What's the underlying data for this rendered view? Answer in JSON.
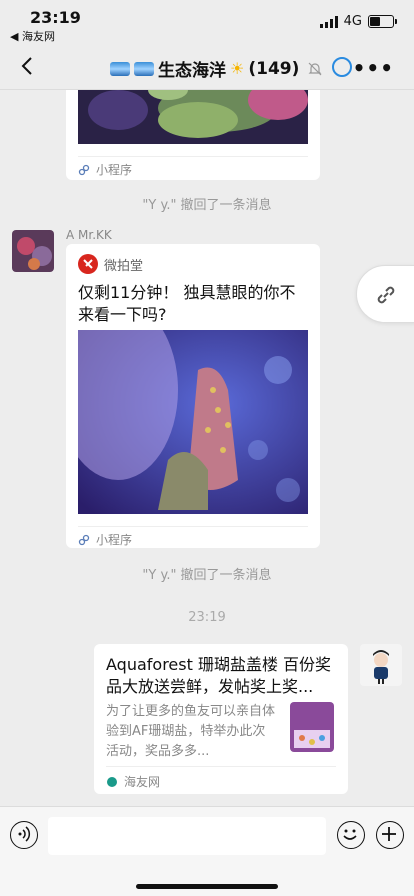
{
  "status_bar": {
    "time": "23:19",
    "back_app": "◀ 海友网",
    "network": "4G",
    "battery_level": 0.45
  },
  "nav": {
    "title": "生态海洋",
    "member_count": "(149)"
  },
  "messages": {
    "card1": {
      "footer": "小程序"
    },
    "recall1": "\"Y y.\" 撤回了一条消息",
    "sender2": "A  Mr.KK",
    "card2": {
      "source": "微拍堂",
      "title": "仅剩11分钟！ 独具慧眼的你不来看一下吗?",
      "footer": "小程序"
    },
    "recall2": "\"Y y.\" 撤回了一条消息",
    "time": "23:19",
    "card3": {
      "title": "Aquaforest 珊瑚盐盖楼 百份奖品大放送尝鲜，发帖奖上奖...",
      "desc": "为了让更多的鱼友可以亲自体验到AF珊瑚盐，特举办此次活动，奖品多多...",
      "source": "海友网"
    }
  },
  "input": {
    "placeholder": ""
  },
  "colors": {
    "background": "#ededed",
    "card": "#ffffff",
    "accent_blue": "#2a8be0",
    "system_text": "#999999"
  }
}
